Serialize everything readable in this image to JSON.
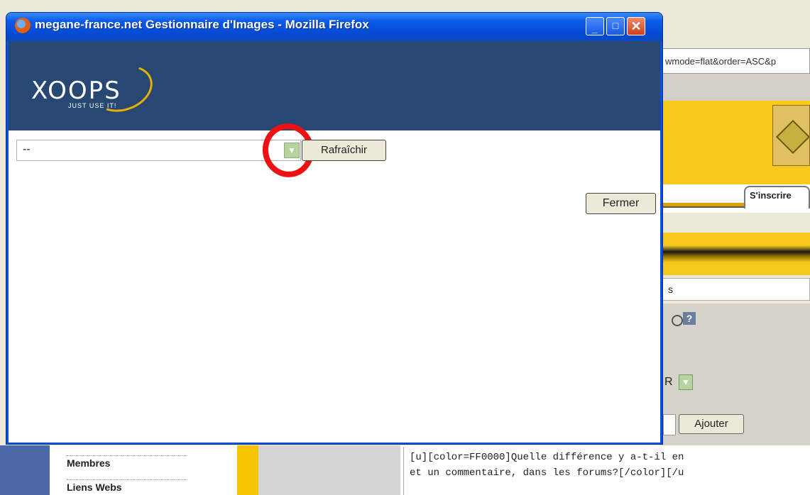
{
  "window": {
    "title": "megane-france.net Gestionnaire d'Images - Mozilla Firefox",
    "buttons": {
      "minimize": "_",
      "maximize": "□",
      "close": "✕"
    }
  },
  "header": {
    "logo_text": "XOOPS",
    "logo_tagline": "JUST USE IT!"
  },
  "image_manager": {
    "category_select": {
      "value": "--"
    },
    "refresh_label": "Rafraîchir",
    "close_label": "Fermer"
  },
  "background_page": {
    "url_fragment": "wmode=flat&order=ASC&p",
    "tab_label": "S'inscrire",
    "input_text": "s",
    "select_value": "R",
    "ajouter_label": "Ajouter",
    "nav_items": [
      "Membres",
      "Liens Webs"
    ],
    "code_lines": [
      "[u][color=FF0000]Quelle différence y a-t-il en",
      "et un commentaire, dans les forums?[/color][/u"
    ]
  },
  "colors": {
    "titlebar": "#0a5ae8",
    "header": "#264872",
    "annotation": "#ee1111",
    "accent_yellow": "#f7c91c"
  }
}
